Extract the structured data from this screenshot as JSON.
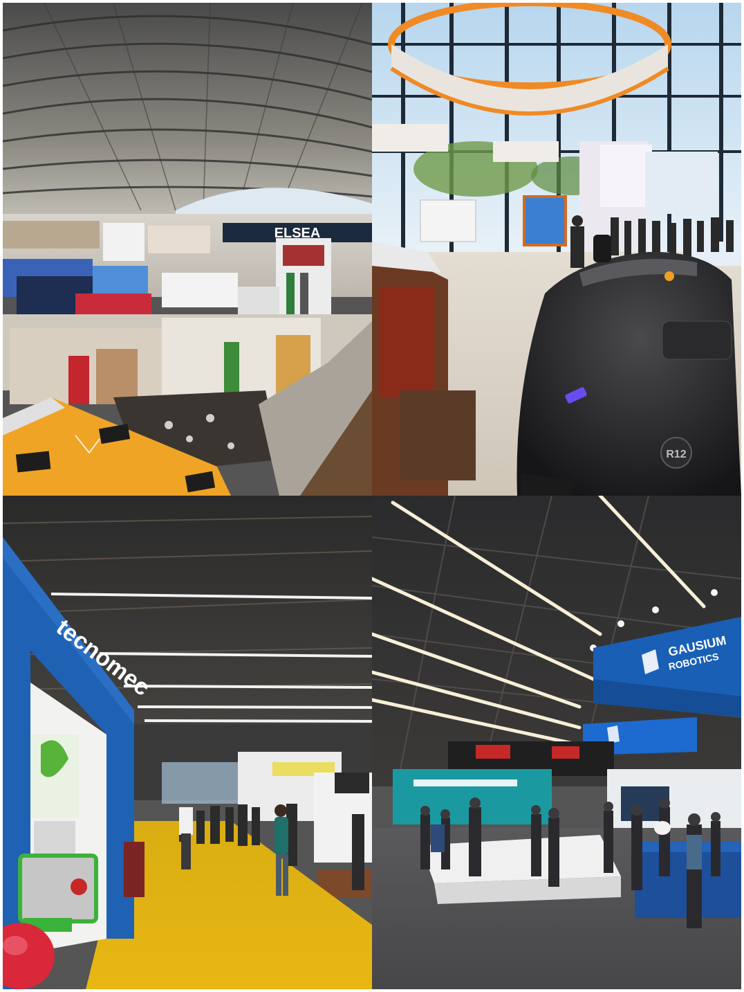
{
  "collage": {
    "photos": [
      {
        "id": "exhibition-hall-overview",
        "signs": {
          "main_banner": "ELSEA"
        }
      },
      {
        "id": "cleaning-robot-foyer",
        "signs": {
          "robot_badge": "R12"
        }
      },
      {
        "id": "yellow-carpet-aisle",
        "signs": {
          "stand_brand": "tecnomec"
        }
      },
      {
        "id": "robotics-stand-hall",
        "signs": {
          "hanging_banner_line1": "GAUSIUM",
          "hanging_banner_line2": "ROBOTICS"
        }
      }
    ]
  }
}
